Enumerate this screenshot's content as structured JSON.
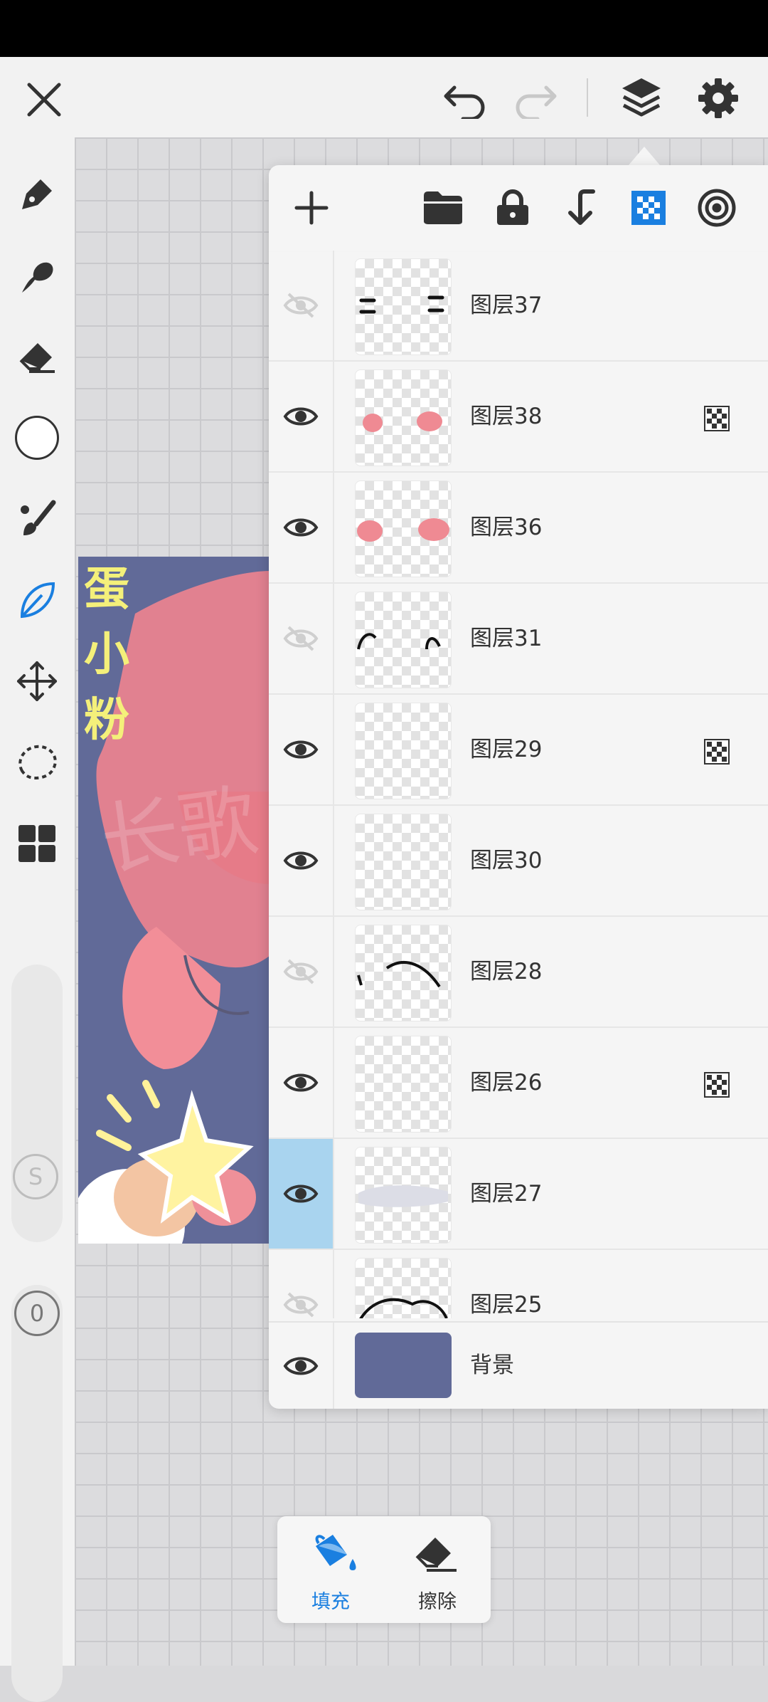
{
  "colors": {
    "accent": "#1a7fe0",
    "canvas_bg": "#616a98",
    "selected_row": "#a9d4ef",
    "art_title": "#f4f07a"
  },
  "top_bar": {
    "icons": [
      "close-icon",
      "undo-icon",
      "redo-icon",
      "layers-icon",
      "settings-icon"
    ]
  },
  "left_toolbar": {
    "tools": [
      "pen-icon",
      "smudge-icon",
      "eraser-icon",
      "color-swatch",
      "brush-icon",
      "leaf-brush-icon",
      "move-icon",
      "lasso-icon",
      "grid-icon"
    ],
    "size_label": "S",
    "opacity_label": "0"
  },
  "artwork": {
    "title_chars": [
      "蛋",
      "小",
      "粉"
    ],
    "watermark": "长歌"
  },
  "layer_panel": {
    "toolbar_icons": [
      "add-layer-icon",
      "folder-icon",
      "lock-icon",
      "merge-down-icon",
      "alpha-checker-icon",
      "reference-icon"
    ],
    "layers": [
      {
        "name": "图层37",
        "visible": false,
        "alpha_lock": false,
        "selected": false
      },
      {
        "name": "图层38",
        "visible": true,
        "alpha_lock": true,
        "selected": false
      },
      {
        "name": "图层36",
        "visible": true,
        "alpha_lock": false,
        "selected": false
      },
      {
        "name": "图层31",
        "visible": false,
        "alpha_lock": false,
        "selected": false
      },
      {
        "name": "图层29",
        "visible": true,
        "alpha_lock": true,
        "selected": false
      },
      {
        "name": "图层30",
        "visible": true,
        "alpha_lock": false,
        "selected": false
      },
      {
        "name": "图层28",
        "visible": false,
        "alpha_lock": false,
        "selected": false
      },
      {
        "name": "图层26",
        "visible": true,
        "alpha_lock": true,
        "selected": false
      },
      {
        "name": "图层27",
        "visible": true,
        "alpha_lock": false,
        "selected": true
      },
      {
        "name": "图层25",
        "visible": false,
        "alpha_lock": false,
        "selected": false
      }
    ],
    "background_layer": {
      "name": "背景",
      "visible": true,
      "color": "#616a98"
    }
  },
  "bottom_popup": {
    "fill_label": "填充",
    "erase_label": "擦除"
  }
}
